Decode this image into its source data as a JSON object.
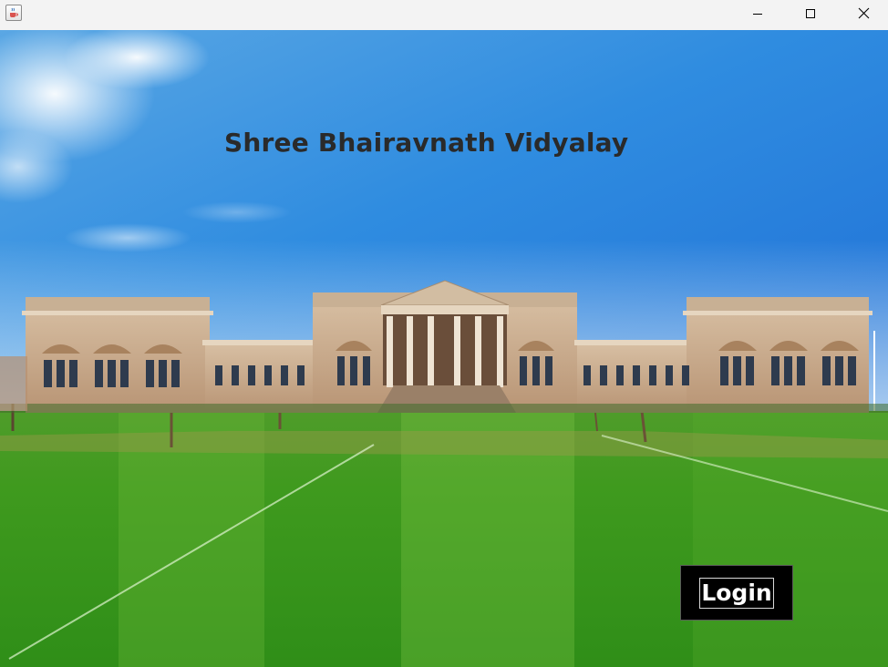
{
  "window": {
    "icon": "java-cup-icon",
    "controls": [
      "minimize-icon",
      "maximize-icon",
      "close-icon"
    ]
  },
  "main": {
    "heading": "Shree Bhairavnath Vidyalay",
    "background": "college-campus-photo",
    "login_label": "Login"
  },
  "colors": {
    "heading": "#2a2a2a",
    "button_bg": "#000000",
    "button_text": "#ffffff",
    "titlebar": "#f3f3f3"
  }
}
